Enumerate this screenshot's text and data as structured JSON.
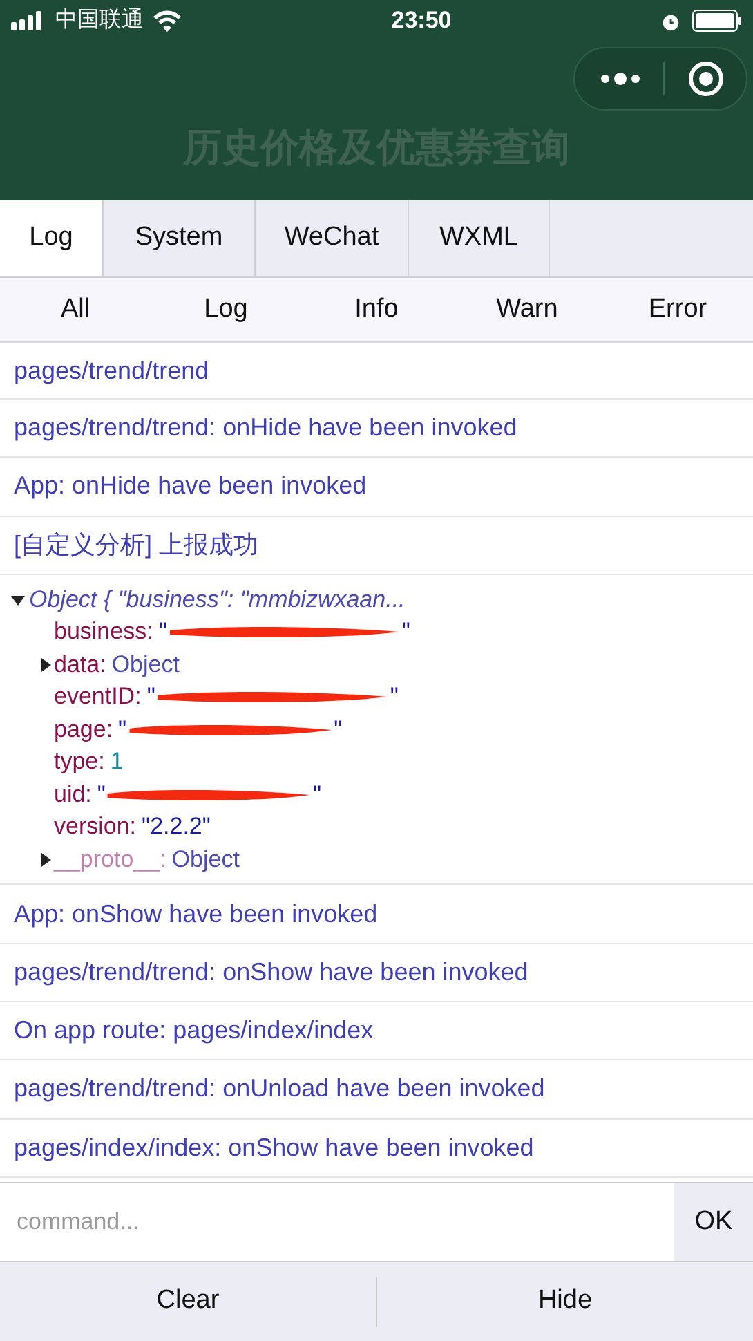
{
  "status_bar": {
    "carrier": "中国联通",
    "time": "23:50"
  },
  "nav": {
    "title": "历史价格及优惠券查询"
  },
  "tabs": [
    {
      "label": "Log",
      "selected": true
    },
    {
      "label": "System",
      "selected": false
    },
    {
      "label": "WeChat",
      "selected": false
    },
    {
      "label": "WXML",
      "selected": false
    }
  ],
  "filters": [
    {
      "label": "All"
    },
    {
      "label": "Log"
    },
    {
      "label": "Info"
    },
    {
      "label": "Warn"
    },
    {
      "label": "Error"
    }
  ],
  "logs": [
    {
      "kind": "text",
      "text": "pages/trend/trend"
    },
    {
      "kind": "text",
      "text": "pages/trend/trend: onHide have been invoked"
    },
    {
      "kind": "text",
      "text": "App: onHide have been invoked"
    },
    {
      "kind": "text",
      "text": "[自定义分析] 上报成功"
    },
    {
      "kind": "object",
      "summary": "Object { \"business\": \"mmbizwxaan...",
      "expanded": true,
      "props": [
        {
          "key": "business:",
          "value": "\"",
          "suffix": "\"",
          "redacted": true,
          "kind": "string",
          "expandable": false,
          "internal": false
        },
        {
          "key": "data:",
          "value": "Object",
          "kind": "object",
          "expandable": true,
          "internal": false
        },
        {
          "key": "eventID:",
          "value": "\"",
          "suffix": "\"",
          "redacted": true,
          "kind": "string",
          "expandable": false,
          "internal": false
        },
        {
          "key": "page:",
          "value": "\"",
          "suffix": "\"",
          "redacted": true,
          "kind": "string",
          "expandable": false,
          "internal": false
        },
        {
          "key": "type:",
          "value": "1",
          "kind": "number",
          "expandable": false,
          "internal": false
        },
        {
          "key": "uid:",
          "value": "\"",
          "suffix": "\"",
          "redacted": true,
          "kind": "string",
          "expandable": false,
          "internal": false
        },
        {
          "key": "version:",
          "value": "\"2.2.2\"",
          "kind": "string",
          "expandable": false,
          "internal": false
        },
        {
          "key": "__proto__:",
          "value": "Object",
          "kind": "object",
          "expandable": true,
          "internal": true
        }
      ]
    },
    {
      "kind": "text",
      "text": "App: onShow have been invoked"
    },
    {
      "kind": "text",
      "text": "pages/trend/trend: onShow have been invoked"
    },
    {
      "kind": "text",
      "text": "On app route: pages/index/index"
    },
    {
      "kind": "text",
      "text": "pages/trend/trend: onUnload have been invoked"
    },
    {
      "kind": "text",
      "text": "pages/index/index: onShow have been invoked"
    }
  ],
  "command": {
    "placeholder": "command...",
    "button": "OK"
  },
  "footer": [
    {
      "label": "Clear"
    },
    {
      "label": "Hide"
    }
  ]
}
